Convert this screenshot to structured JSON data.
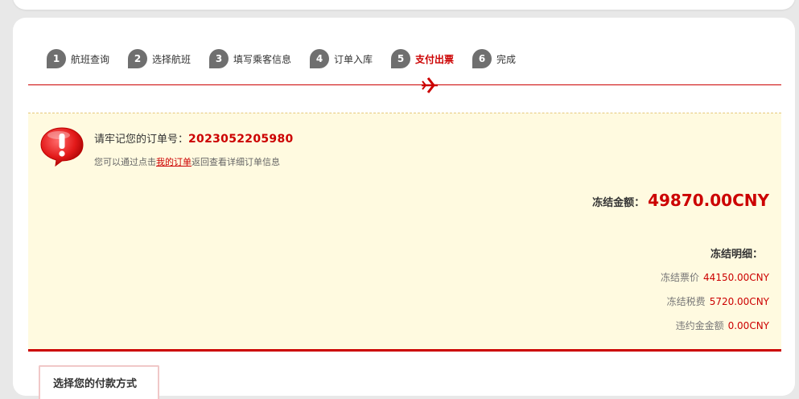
{
  "steps": [
    {
      "num": "1",
      "label": "航班查询",
      "active": false
    },
    {
      "num": "2",
      "label": "选择航班",
      "active": false
    },
    {
      "num": "3",
      "label": "填写乘客信息",
      "active": false
    },
    {
      "num": "4",
      "label": "订单入库",
      "active": false
    },
    {
      "num": "5",
      "label": "支付出票",
      "active": true
    },
    {
      "num": "6",
      "label": "完成",
      "active": false
    }
  ],
  "order": {
    "prefix": "请牢记您的订单号：",
    "number": "2023052205980",
    "hint_before": "您可以通过点击",
    "hint_link": "我的订单",
    "hint_after": "返回查看详细订单信息"
  },
  "frozen": {
    "total_label": "冻结金额：",
    "total_amount": "49870.00CNY",
    "detail_title": "冻结明细：",
    "rows": [
      {
        "label": "冻结票价",
        "value": "44150.00CNY"
      },
      {
        "label": "冻结税费",
        "value": "5720.00CNY"
      },
      {
        "label": "违约金金额",
        "value": "0.00CNY"
      }
    ]
  },
  "payment": {
    "section_title": "选择您的付款方式"
  },
  "colors": {
    "accent": "#cc0000",
    "panel_bg": "#fffae0",
    "step_badge": "#6f6f6f"
  }
}
